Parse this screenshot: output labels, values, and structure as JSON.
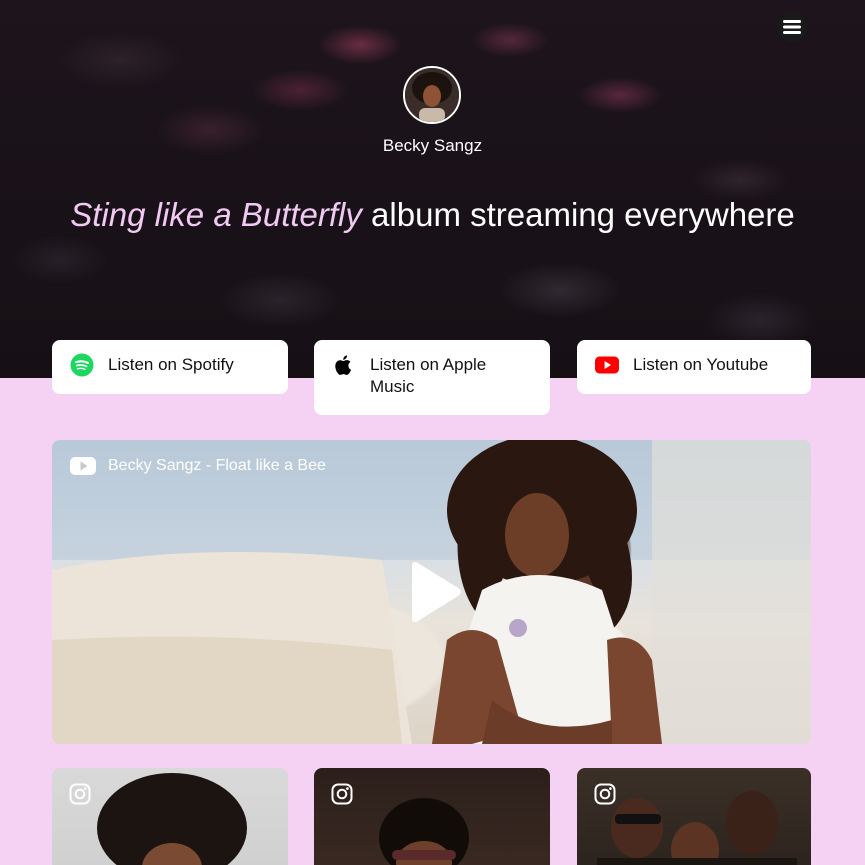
{
  "header": {
    "artist_name": "Becky Sangz",
    "headline_album": "Sting like a Butterfly",
    "headline_rest": " album streaming everywhere",
    "menu_icon": "hamburger-menu-icon"
  },
  "links": [
    {
      "label": "Listen on Spotify",
      "icon": "spotify-icon",
      "icon_color": "#1ed760"
    },
    {
      "label": "Listen on Apple Music",
      "icon": "apple-icon",
      "icon_color": "#000000"
    },
    {
      "label": "Listen on Youtube",
      "icon": "youtube-icon",
      "icon_color": "#ff0000"
    }
  ],
  "video": {
    "title": "Becky Sangz - Float like a Bee",
    "platform_icon": "youtube-icon",
    "play_icon": "play-icon"
  },
  "instagram": {
    "icon": "instagram-icon",
    "posts": [
      "instagram-post-1",
      "instagram-post-2",
      "instagram-post-3"
    ]
  },
  "colors": {
    "background": "#f5d2f3",
    "accent_text": "#f2c9f3",
    "button_bg": "#ffffff"
  }
}
